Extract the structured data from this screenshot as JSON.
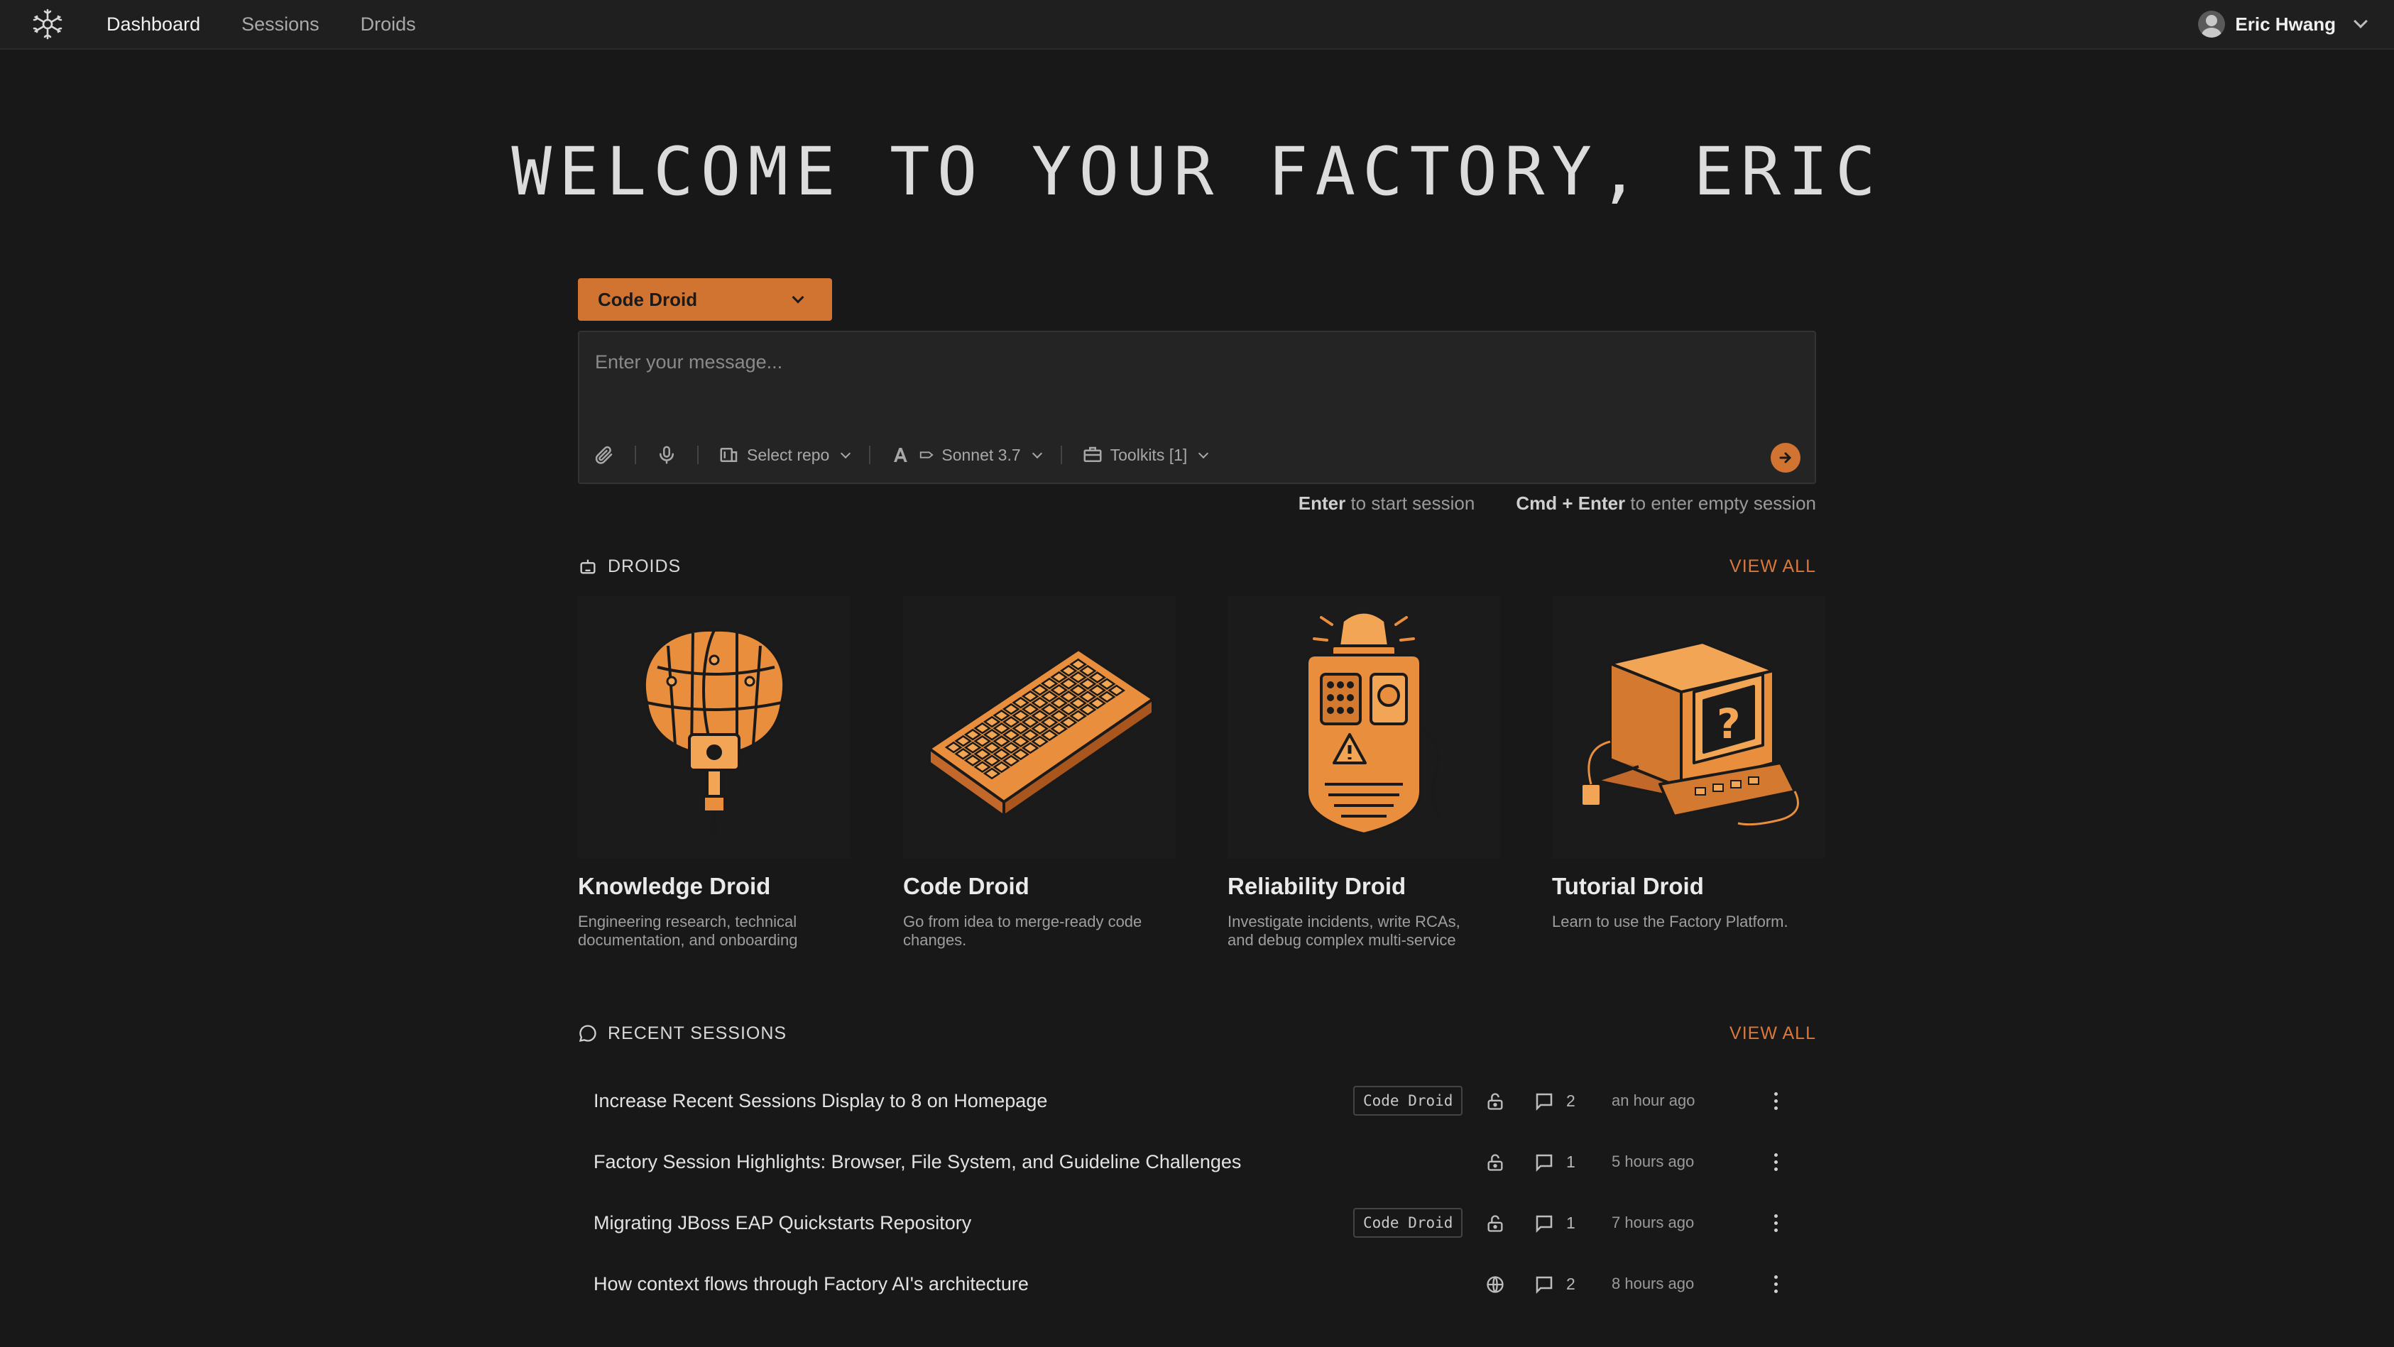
{
  "nav": {
    "items": [
      {
        "label": "Dashboard",
        "active": true
      },
      {
        "label": "Sessions",
        "active": false
      },
      {
        "label": "Droids",
        "active": false
      }
    ],
    "user_name": "Eric Hwang"
  },
  "headline": "WELCOME TO YOUR FACTORY, ERIC",
  "composer": {
    "droid_selected": "Code Droid",
    "placeholder": "Enter your message...",
    "repo_label": "Select repo",
    "model_label": "Sonnet 3.7",
    "toolkits_label": "Toolkits [1]",
    "hint_enter_key": "Enter",
    "hint_enter_text": "to start session",
    "hint_cmd_key": "Cmd + Enter",
    "hint_cmd_text": "to enter empty session"
  },
  "droids": {
    "section_title": "DROIDS",
    "view_all": "VIEW ALL",
    "cards": [
      {
        "title": "Knowledge Droid",
        "desc": "Engineering research, technical documentation, and onboarding",
        "icon": "brain-illustration"
      },
      {
        "title": "Code Droid",
        "desc": "Go from idea to merge-ready code changes.",
        "icon": "keyboard-illustration"
      },
      {
        "title": "Reliability Droid",
        "desc": "Investigate incidents, write RCAs, and debug complex multi-service",
        "icon": "alarm-device-illustration"
      },
      {
        "title": "Tutorial Droid",
        "desc": "Learn to use the Factory Platform.",
        "icon": "retro-computer-illustration"
      }
    ]
  },
  "recent_sessions": {
    "section_title": "RECENT SESSIONS",
    "view_all": "VIEW ALL",
    "rows": [
      {
        "title": "Increase Recent Sessions Display to 8 on Homepage",
        "badge": "Code Droid",
        "visibility": "lock-icon",
        "comments": "2",
        "time": "an hour ago"
      },
      {
        "title": "Factory Session Highlights: Browser, File System, and Guideline Challenges",
        "badge": "",
        "visibility": "lock-icon",
        "comments": "1",
        "time": "5 hours ago"
      },
      {
        "title": "Migrating JBoss EAP Quickstarts Repository",
        "badge": "Code Droid",
        "visibility": "lock-icon",
        "comments": "1",
        "time": "7 hours ago"
      },
      {
        "title": "How context flows through Factory AI's architecture",
        "badge": "",
        "visibility": "globe-icon",
        "comments": "2",
        "time": "8 hours ago"
      }
    ]
  },
  "colors": {
    "accent": "#d17432",
    "background": "#181818",
    "panel": "#242424"
  }
}
